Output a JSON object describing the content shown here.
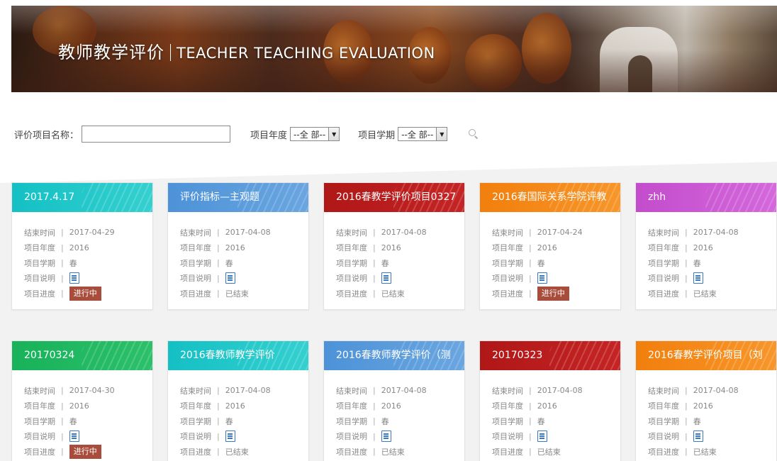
{
  "banner": {
    "title_cn": "教师教学评价",
    "title_en": "TEACHER TEACHING EVALUATION"
  },
  "filters": {
    "name_label": "评价项目名称：",
    "name_value": "",
    "year_label": "项目年度",
    "year_selected": "--全 部--",
    "term_label": "项目学期",
    "term_selected": "--全 部--"
  },
  "labels": {
    "end_time": "结束时间",
    "year": "项目年度",
    "term": "项目学期",
    "desc": "项目说明",
    "progress": "项目进度",
    "separator": "|"
  },
  "colors": {
    "teal": "#14c0c4",
    "blue": "#4d92d8",
    "red": "#b01717",
    "orange": "#f27f0c",
    "purple": "#c34ccc",
    "green": "#17b25a",
    "status_active": "#a84d3b"
  },
  "cards": [
    {
      "title": "2017.4.17",
      "color": "teal",
      "end_time": "2017-04-29",
      "year": "2016",
      "term": "春",
      "status": "进行中",
      "active": true
    },
    {
      "title": "评价指标—主观题",
      "color": "blue",
      "end_time": "2017-04-08",
      "year": "2016",
      "term": "春",
      "status": "已结束",
      "active": false
    },
    {
      "title": "2016春教学评价项目0327",
      "color": "red",
      "end_time": "2017-04-08",
      "year": "2016",
      "term": "春",
      "status": "已结束",
      "active": false
    },
    {
      "title": "2016春国际关系学院评教",
      "color": "orange",
      "end_time": "2017-04-24",
      "year": "2016",
      "term": "春",
      "status": "进行中",
      "active": true
    },
    {
      "title": "zhh",
      "color": "purple",
      "end_time": "2017-04-08",
      "year": "2016",
      "term": "春",
      "status": "已结束",
      "active": false
    },
    {
      "title": "20170324",
      "color": "green",
      "end_time": "2017-04-30",
      "year": "2016",
      "term": "春",
      "status": "进行中",
      "active": true
    },
    {
      "title": "2016春教师教学评价",
      "color": "teal",
      "end_time": "2017-04-08",
      "year": "2016",
      "term": "春",
      "status": "已结束",
      "active": false
    },
    {
      "title": "2016春教师教学评价（测",
      "color": "blue",
      "end_time": "2017-04-08",
      "year": "2016",
      "term": "春",
      "status": "已结束",
      "active": false
    },
    {
      "title": "20170323",
      "color": "red",
      "end_time": "2017-04-08",
      "year": "2016",
      "term": "春",
      "status": "已结束",
      "active": false
    },
    {
      "title": "2016春教学评价项目（刘",
      "color": "orange",
      "end_time": "2017-04-08",
      "year": "2016",
      "term": "春",
      "status": "已结束",
      "active": false
    }
  ]
}
